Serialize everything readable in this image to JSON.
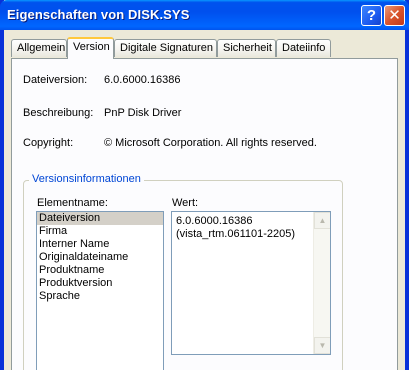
{
  "window": {
    "title": "Eigenschaften von DISK.SYS",
    "help_glyph": "?",
    "close_glyph": "✕"
  },
  "tabs": [
    {
      "label": "Allgemein",
      "active": false
    },
    {
      "label": "Version",
      "active": true
    },
    {
      "label": "Digitale Signaturen",
      "active": false
    },
    {
      "label": "Sicherheit",
      "active": false
    },
    {
      "label": "Dateiinfo",
      "active": false
    }
  ],
  "info": {
    "file_version_label": "Dateiversion:",
    "file_version_value": "6.0.6000.16386",
    "description_label": "Beschreibung:",
    "description_value": "PnP Disk Driver",
    "copyright_label": "Copyright:",
    "copyright_value": "© Microsoft Corporation. All rights reserved."
  },
  "version_info": {
    "group_label": "Versionsinformationen",
    "element_name_header": "Elementname:",
    "value_header": "Wert:",
    "items": [
      "Dateiversion",
      "Firma",
      "Interner Name",
      "Originaldateiname",
      "Produktname",
      "Produktversion",
      "Sprache"
    ],
    "selected_item": "Dateiversion",
    "selected_value": "6.0.6000.16386\n(vista_rtm.061101-2205)",
    "scroll_up_glyph": "▲",
    "scroll_down_glyph": "▼"
  },
  "colors": {
    "titlebar": "#0053ee",
    "window_bg": "#ece9d8",
    "group_label": "#0046d5",
    "active_tab_accent": "#ffc83c",
    "close_button": "#d9542c"
  }
}
